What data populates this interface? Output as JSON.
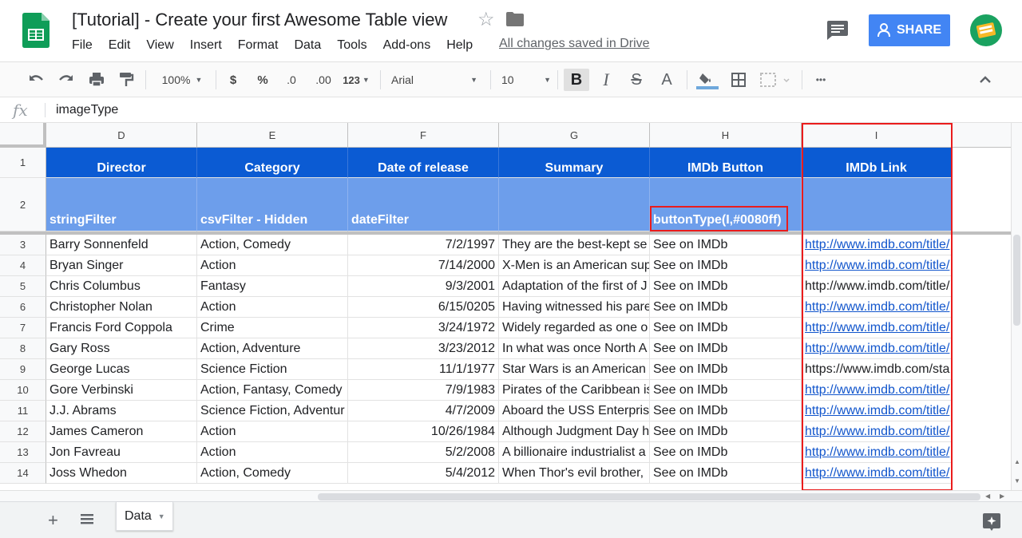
{
  "doc": {
    "title": "[Tutorial] - Create your first Awesome Table view",
    "save_status": "All changes saved in Drive",
    "share_label": "SHARE"
  },
  "menu": [
    "File",
    "Edit",
    "View",
    "Insert",
    "Format",
    "Data",
    "Tools",
    "Add-ons",
    "Help"
  ],
  "toolbar": {
    "zoom": "100%",
    "currency": "$",
    "percent": "%",
    "dec_decrease": ".0",
    "dec_increase": ".00",
    "more_formats": "123",
    "font": "Arial",
    "font_size": "10",
    "bold": "B",
    "italic": "I",
    "strike": "S",
    "text_color": "A",
    "more": "•••"
  },
  "formula": {
    "fx": "fx",
    "value": "imageType"
  },
  "grid": {
    "columns": [
      "D",
      "E",
      "F",
      "G",
      "H",
      "I"
    ],
    "header_row": [
      "Director",
      "Category",
      "Date of release",
      "Summary",
      "IMDb Button",
      "IMDb Link"
    ],
    "filter_row": [
      "stringFilter",
      "csvFilter - Hidden",
      "dateFilter",
      "",
      "buttonType(I,#0080ff)",
      ""
    ],
    "row_numbers": [
      "1",
      "2",
      "3",
      "4",
      "5",
      "6",
      "7",
      "8",
      "9",
      "10",
      "11",
      "12",
      "13",
      "14"
    ],
    "rows": [
      [
        "Barry Sonnenfeld",
        "Action, Comedy",
        "7/2/1997",
        "They are the best-kept se",
        "See on IMDb",
        "http://www.imdb.com/title/"
      ],
      [
        "Bryan Singer",
        "Action",
        "7/14/2000",
        "X-Men is an American sup",
        "See on IMDb",
        "http://www.imdb.com/title/"
      ],
      [
        "Chris Columbus",
        "Fantasy",
        "9/3/2001",
        "Adaptation of the first of J",
        "See on IMDb",
        "http://www.imdb.com/title/"
      ],
      [
        "Christopher Nolan",
        "Action",
        "6/15/0205",
        "Having witnessed his pare",
        "See on IMDb",
        "http://www.imdb.com/title/"
      ],
      [
        "Francis Ford Coppola",
        "Crime",
        "3/24/1972",
        "Widely regarded as one o",
        "See on IMDb",
        "http://www.imdb.com/title/"
      ],
      [
        "Gary Ross",
        "Action, Adventure",
        "3/23/2012",
        "In what was once North A",
        "See on IMDb",
        "http://www.imdb.com/title/"
      ],
      [
        "George Lucas",
        "Science Fiction",
        "11/1/1977",
        "Star Wars is an American",
        "See on IMDb",
        "https://www.imdb.com/sta"
      ],
      [
        "Gore Verbinski",
        "Action, Fantasy, Comedy",
        "7/9/1983",
        "Pirates of the Caribbean is",
        "See on IMDb",
        "http://www.imdb.com/title/"
      ],
      [
        "J.J. Abrams",
        "Science Fiction, Adventur",
        "4/7/2009",
        "Aboard the USS Enterpris",
        "See on IMDb",
        "http://www.imdb.com/title/"
      ],
      [
        "James Cameron",
        "Action",
        "10/26/1984",
        "Although Judgment Day h",
        "See on IMDb",
        "http://www.imdb.com/title/"
      ],
      [
        "Jon Favreau",
        "Action",
        "5/2/2008",
        "A billionaire industrialist a",
        "See on IMDb",
        "http://www.imdb.com/title/"
      ],
      [
        "Joss Whedon",
        "Action, Comedy",
        "5/4/2012",
        "When Thor's evil brother,",
        "See on IMDb",
        "http://www.imdb.com/title/"
      ]
    ],
    "plain_link_rows": [
      2,
      6
    ]
  },
  "sheets": {
    "active_tab": "Data"
  },
  "colors": {
    "header_blue": "#0b5bd3",
    "filter_blue": "#6d9eeb",
    "share_blue": "#4285f4",
    "highlight_red": "#ea1c1c",
    "link_blue": "#1155cc"
  }
}
